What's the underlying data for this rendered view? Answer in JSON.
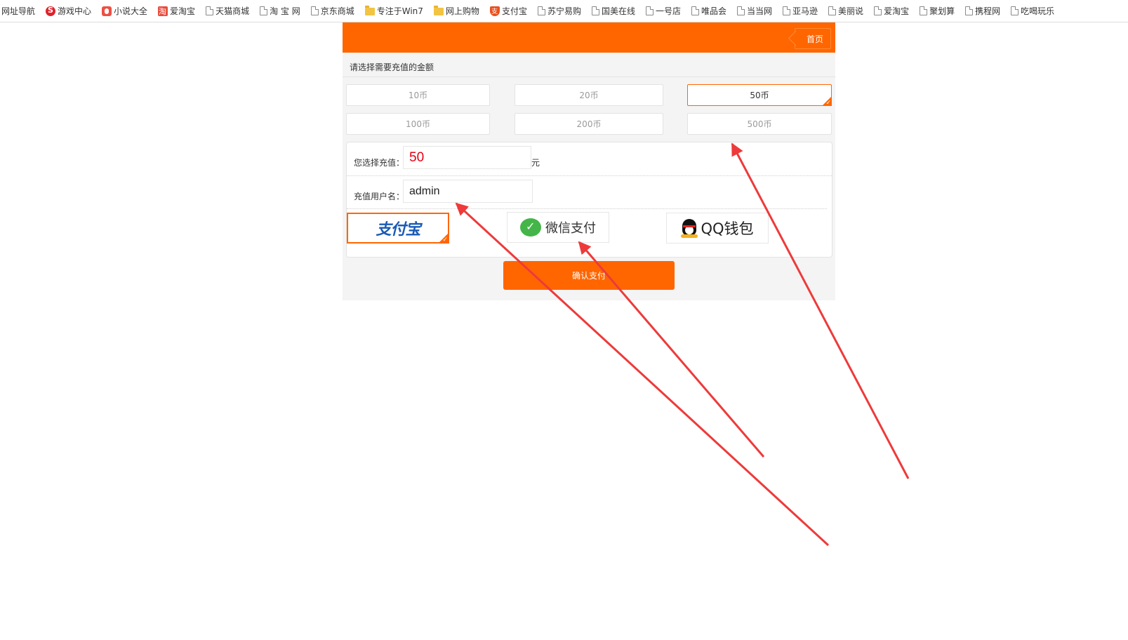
{
  "bookmarks": [
    {
      "label": "网址导航",
      "icon": "none"
    },
    {
      "label": "游戏中心",
      "icon": "red-round"
    },
    {
      "label": "小说大全",
      "icon": "red-sq"
    },
    {
      "label": "爱淘宝",
      "icon": "taobao"
    },
    {
      "label": "天猫商城",
      "icon": "page"
    },
    {
      "label": "淘 宝 网",
      "icon": "page"
    },
    {
      "label": "京东商城",
      "icon": "page"
    },
    {
      "label": "专注于Win7",
      "icon": "folder"
    },
    {
      "label": "网上购物",
      "icon": "folder"
    },
    {
      "label": "支付宝",
      "icon": "shield"
    },
    {
      "label": "苏宁易购",
      "icon": "page"
    },
    {
      "label": "国美在线",
      "icon": "page"
    },
    {
      "label": "一号店",
      "icon": "page"
    },
    {
      "label": "唯品会",
      "icon": "page"
    },
    {
      "label": "当当网",
      "icon": "page"
    },
    {
      "label": "亚马逊",
      "icon": "page"
    },
    {
      "label": "美丽说",
      "icon": "page"
    },
    {
      "label": "爱淘宝",
      "icon": "page"
    },
    {
      "label": "聚划算",
      "icon": "page"
    },
    {
      "label": "携程网",
      "icon": "page"
    },
    {
      "label": "吃喝玩乐",
      "icon": "page"
    }
  ],
  "header": {
    "home_label": "首页",
    "accent_color": "#ff6600"
  },
  "prompt": "请选择需要充值的金额",
  "amounts": [
    {
      "label": "10币",
      "selected": false
    },
    {
      "label": "20币",
      "selected": false
    },
    {
      "label": "50币",
      "selected": true
    },
    {
      "label": "100币",
      "selected": false
    },
    {
      "label": "200币",
      "selected": false
    },
    {
      "label": "500币",
      "selected": false
    }
  ],
  "form": {
    "amount_label": "您选择充值：",
    "amount_value": "50",
    "amount_unit": "元",
    "user_label": "充值用户名：",
    "user_value": "admin"
  },
  "payments": [
    {
      "name": "alipay",
      "label": "支付宝",
      "selected": true
    },
    {
      "name": "wechat",
      "label": "微信支付",
      "selected": false
    },
    {
      "name": "qq",
      "label": "QQ钱包",
      "selected": false
    }
  ],
  "confirm_label": "确认支付",
  "annotation_color": "#ee3a3a"
}
